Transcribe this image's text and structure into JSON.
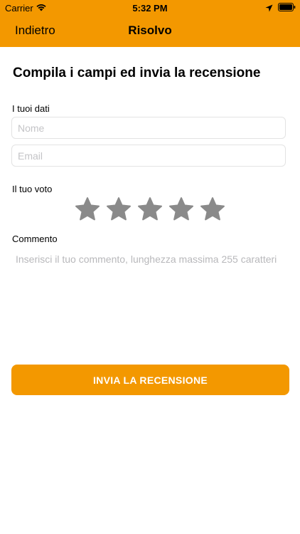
{
  "status_bar": {
    "carrier": "Carrier",
    "time": "5:32 PM",
    "icons": [
      "wifi-icon",
      "location-arrow-icon",
      "battery-icon"
    ]
  },
  "nav": {
    "back_label": "Indietro",
    "title": "Risolvo"
  },
  "form": {
    "title": "Compila i campi ed invia la recensione",
    "data_section_label": "I tuoi dati",
    "name_placeholder": "Nome",
    "name_value": "",
    "email_placeholder": "Email",
    "email_value": "",
    "vote_section_label": "Il tuo voto",
    "rating": {
      "selected": 0,
      "max": 5
    },
    "comment_section_label": "Commento",
    "comment_placeholder": "Inserisci il tuo commento, lunghezza massima 255 caratteri",
    "comment_value": "",
    "submit_label": "INVIA LA RECENSIONE"
  },
  "colors": {
    "accent": "#F39800",
    "star_empty": "#8a8a8a",
    "placeholder": "#c4c4c7"
  }
}
